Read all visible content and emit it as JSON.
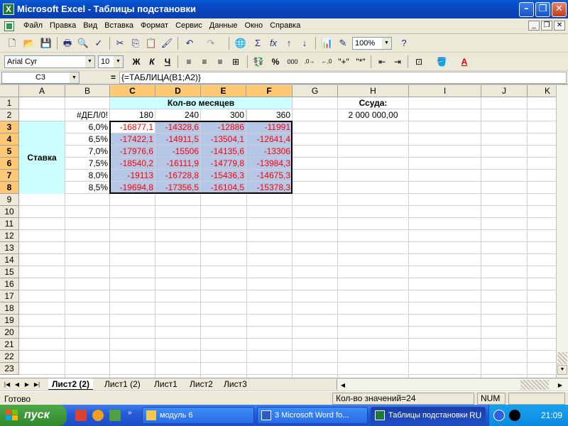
{
  "window": {
    "title": "Microsoft Excel - Таблицы подстановки"
  },
  "menu": [
    "Файл",
    "Правка",
    "Вид",
    "Вставка",
    "Формат",
    "Сервис",
    "Данные",
    "Окно",
    "Справка"
  ],
  "toolbar": {
    "zoom": "100%",
    "font_name": "Arial Cyr",
    "font_size": "10",
    "bold": "Ж",
    "italic": "К",
    "underline": "Ч",
    "percent": "%",
    "thousands": "000",
    "inc_decimal": ",0\n,00",
    "dec_decimal": ",00\n,0"
  },
  "formula_bar": {
    "name_box": "C3",
    "equals": "=",
    "formula": "{=ТАБЛИЦА(B1;A2)}"
  },
  "columns": [
    "A",
    "B",
    "C",
    "D",
    "E",
    "F",
    "G",
    "H",
    "I",
    "J",
    "K"
  ],
  "rows": [
    "1",
    "2",
    "3",
    "4",
    "5",
    "6",
    "7",
    "8",
    "9",
    "10",
    "11",
    "12",
    "13",
    "14",
    "15",
    "16",
    "17",
    "18",
    "19",
    "20",
    "21",
    "22",
    "23"
  ],
  "sheet": {
    "c1_header": "Кол-во месяцев",
    "h1": "Ссуда:",
    "b2": "#ДЕЛ/0!",
    "months": [
      "180",
      "240",
      "300",
      "360"
    ],
    "h2": "2 000 000,00",
    "rate_label": "Ставка",
    "rates": [
      "6,0%",
      "6,5%",
      "7,0%",
      "7,5%",
      "8,0%",
      "8,5%"
    ],
    "table": [
      [
        "-16877,1",
        "-14328,6",
        "-12886",
        "-11991"
      ],
      [
        "-17422,1",
        "-14911,5",
        "-13504,1",
        "-12641,4"
      ],
      [
        "-17976,6",
        "-15506",
        "-14135,6",
        "-13306"
      ],
      [
        "-18540,2",
        "-16111,9",
        "-14779,8",
        "-13984,3"
      ],
      [
        "-19113",
        "-16728,8",
        "-15436,3",
        "-14675,3"
      ],
      [
        "-19694,8",
        "-17356,5",
        "-16104,5",
        "-15378,3"
      ]
    ]
  },
  "tabs": [
    "Лист2 (2)",
    "Лист1 (2)",
    "Лист1",
    "Лист2",
    "Лист3"
  ],
  "status": {
    "ready": "Готово",
    "count": "Кол-во значений=24",
    "num": "NUM"
  },
  "taskbar": {
    "start": "пуск",
    "tasks": [
      "модуль 6",
      "3 Microsoft Word fo...",
      "Таблицы подстановки"
    ],
    "lang": "RU",
    "clock": "21:09"
  },
  "colors": {
    "header_fill": "#ccffff",
    "selection_fill": "#b5c7e6",
    "negative_text": "#ff0000",
    "selected_header": "#ffc874"
  }
}
